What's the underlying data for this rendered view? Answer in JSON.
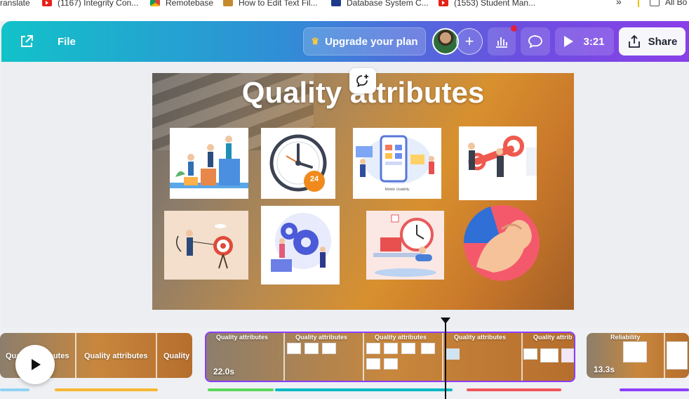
{
  "bookmarks": [
    {
      "label": "ranslate",
      "icon": "translate-icon"
    },
    {
      "label": "(1167) Integrity Con...",
      "icon": "youtube-icon"
    },
    {
      "label": "Remotebase",
      "icon": "chrome-icon"
    },
    {
      "label": "How to Edit Text Fil...",
      "icon": "leaf-icon"
    },
    {
      "label": "Database System C...",
      "icon": "book-icon"
    },
    {
      "label": "(1553) Student Man...",
      "icon": "youtube-icon"
    }
  ],
  "bookmarks_more": "»",
  "bookmarks_folder": "All Bo",
  "header": {
    "file_label": "File",
    "upgrade_label": "Upgrade your plan",
    "upgrade_icon": "crown-icon",
    "add_label": "+",
    "present_label": "3:21",
    "share_label": "Share",
    "accent_gradient": [
      "#12c2c9",
      "#2f8fd6",
      "#6b4fe0",
      "#8a3fe8"
    ],
    "notification_color": "#e41f3a"
  },
  "slide": {
    "title": "Quality attributes",
    "images": [
      "teamwork-stairs-illustration",
      "clock-24-illustration",
      "mobile-usability-illustration",
      "key-security-illustration",
      "archer-target-illustration",
      "gears-illustration",
      "time-management-illustration",
      "strong-arm-illustration"
    ],
    "mobile_caption": "Mobile Usability",
    "clock_badge": "24"
  },
  "timeline": {
    "clips": [
      {
        "labels": [
          "Quality attributes",
          "Quality attributes",
          "Quality a"
        ],
        "duration": ""
      },
      {
        "labels": [
          "Quality attributes",
          "Quality attributes",
          "Quality attributes",
          "Quality attributes",
          "Quality attrib"
        ],
        "duration": "22.0s"
      },
      {
        "labels": [
          "Reliability"
        ],
        "duration": "13.3s"
      }
    ],
    "selected_color": "#8b3dff",
    "progress_bar_colors": [
      "#8fd3f4",
      "#f7b731",
      "#5cd85a",
      "#00b8c4",
      "#f2545b",
      "#8b3dff"
    ]
  }
}
